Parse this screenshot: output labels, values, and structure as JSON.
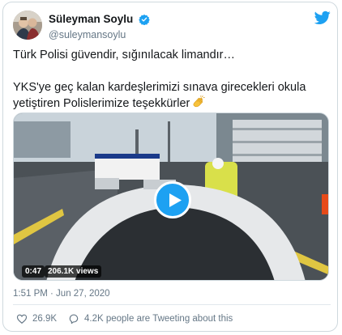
{
  "tweet": {
    "author": {
      "display_name": "Süleyman Soylu",
      "handle": "@suleymansoylu",
      "verified": true
    },
    "text_line1": "Türk Polisi güvendir, sığınılacak limandır…",
    "text_line2": "YKS'ye geç kalan kardeşlerimizi sınava girecekleri okula yetiştiren Polislerimize teşekkürler",
    "emoji": "clapping-hands-icon",
    "media": {
      "type": "video",
      "duration": "0:47",
      "views": "206.1K views"
    },
    "timestamp": "1:51 PM · Jun 27, 2020",
    "likes": "26.9K",
    "talking": "4.2K people are Tweeting about this"
  },
  "colors": {
    "brand": "#1da1f2",
    "text": "#14171a",
    "muted": "#657786",
    "like_icon": "#657786"
  }
}
